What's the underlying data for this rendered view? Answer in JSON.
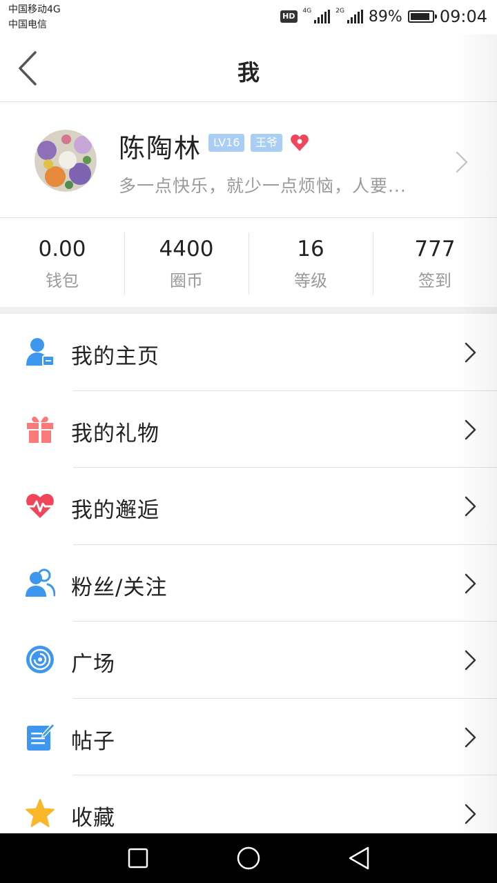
{
  "status_bar": {
    "carrier_1": "中国移动4G",
    "carrier_2": "中国电信",
    "hd": "HD",
    "net_1": "4G",
    "net_2": "2G",
    "battery_percent": "89%",
    "battery_level": 0.89,
    "time": "09:04"
  },
  "header": {
    "title": "我",
    "back_icon": "chevron-left-icon"
  },
  "profile": {
    "name": "陈陶林",
    "level_badge": "LV16",
    "title_badge": "王爷",
    "signature": "多一点快乐，就少一点烦恼，人要...",
    "heart_color": "#f0465a",
    "badge_color": "#a9cdf3"
  },
  "stats": [
    {
      "value": "0.00",
      "label": "钱包"
    },
    {
      "value": "4400",
      "label": "圈币"
    },
    {
      "value": "16",
      "label": "等级"
    },
    {
      "value": "777",
      "label": "签到"
    }
  ],
  "menu": [
    {
      "label": "我的主页",
      "icon": "user-card-icon"
    },
    {
      "label": "我的礼物",
      "icon": "gift-icon"
    },
    {
      "label": "我的邂逅",
      "icon": "heartbeat-icon"
    },
    {
      "label": "粉丝/关注",
      "icon": "users-icon"
    },
    {
      "label": "广场",
      "icon": "target-icon"
    },
    {
      "label": "帖子",
      "icon": "post-edit-icon"
    },
    {
      "label": "收藏",
      "icon": "star-icon"
    }
  ],
  "colors": {
    "accent_blue": "#3d97ee",
    "gift_red": "#fa7a7a",
    "heart_red": "#f0465a",
    "star_yellow": "#f8b82a"
  },
  "navbar": {
    "icons": [
      "recent-apps-icon",
      "home-icon",
      "back-triangle-icon"
    ]
  }
}
